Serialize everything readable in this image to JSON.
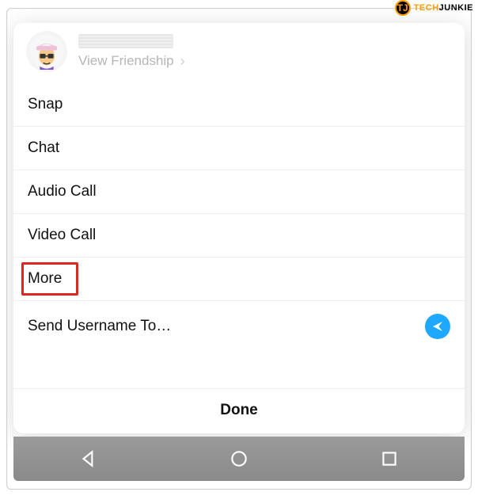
{
  "watermark": {
    "logo_letters": "TJ",
    "brand_part1": "TECH",
    "brand_part2": "JUNKIE"
  },
  "header": {
    "view_friendship_label": "View Friendship"
  },
  "menu": {
    "items": [
      {
        "label": "Snap"
      },
      {
        "label": "Chat"
      },
      {
        "label": "Audio Call"
      },
      {
        "label": "Video Call"
      },
      {
        "label": "More",
        "highlighted": true
      },
      {
        "label": "Send Username To…",
        "trailing_icon": "send-icon"
      }
    ]
  },
  "footer": {
    "done_label": "Done"
  },
  "colors": {
    "highlight_border": "#e1261c",
    "send_bg": "#1ea8ff"
  }
}
